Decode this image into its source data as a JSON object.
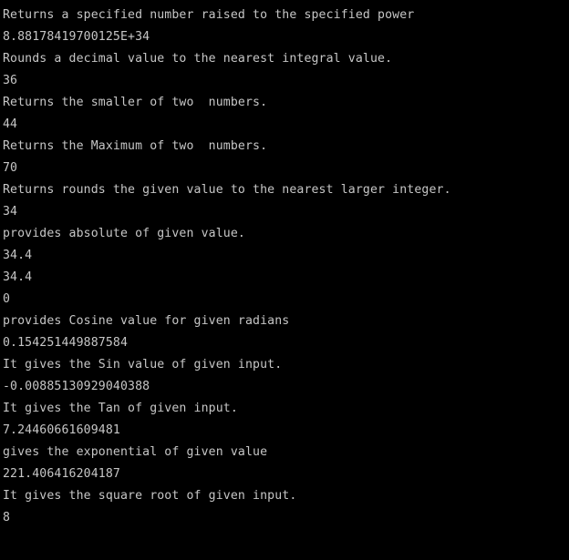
{
  "window": {
    "title": "Console Output",
    "background_color": "#000000",
    "text_color": "#c6c6c6"
  },
  "console": {
    "lines": [
      {
        "kind": "description",
        "text": "Returns a specified number raised to the specified power"
      },
      {
        "kind": "value",
        "text": "8.88178419700125E+34"
      },
      {
        "kind": "description",
        "text": "Rounds a decimal value to the nearest integral value."
      },
      {
        "kind": "value",
        "text": "36"
      },
      {
        "kind": "description",
        "text": "Returns the smaller of two  numbers."
      },
      {
        "kind": "value",
        "text": "44"
      },
      {
        "kind": "description",
        "text": "Returns the Maximum of two  numbers."
      },
      {
        "kind": "value",
        "text": "70"
      },
      {
        "kind": "description",
        "text": "Returns rounds the given value to the nearest larger integer."
      },
      {
        "kind": "value",
        "text": "34"
      },
      {
        "kind": "description",
        "text": "provides absolute of given value."
      },
      {
        "kind": "value",
        "text": "34.4"
      },
      {
        "kind": "value",
        "text": "34.4"
      },
      {
        "kind": "value",
        "text": "0"
      },
      {
        "kind": "description",
        "text": "provides Cosine value for given radians"
      },
      {
        "kind": "value",
        "text": "0.154251449887584"
      },
      {
        "kind": "description",
        "text": "It gives the Sin value of given input."
      },
      {
        "kind": "value",
        "text": "-0.00885130929040388"
      },
      {
        "kind": "description",
        "text": "It gives the Tan of given input."
      },
      {
        "kind": "value",
        "text": "7.24460661609481"
      },
      {
        "kind": "description",
        "text": "gives the exponential of given value"
      },
      {
        "kind": "value",
        "text": "221.406416204187"
      },
      {
        "kind": "description",
        "text": "It gives the square root of given input."
      },
      {
        "kind": "value",
        "text": "8"
      }
    ]
  }
}
